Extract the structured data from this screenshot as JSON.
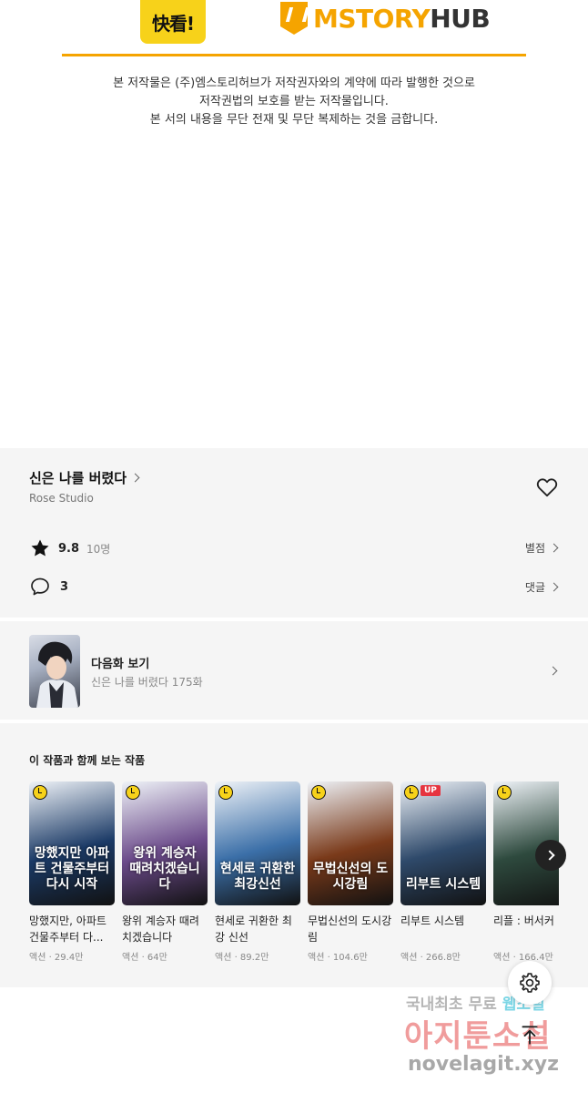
{
  "banner": {
    "logo_kuai_text": "快看!",
    "logo_mstory_part1": "MSTORY",
    "logo_mstory_part2": "HUB",
    "accent_color": "#f5a400"
  },
  "copyright": {
    "line1": "본 저작물은 (주)엠스토리허브가 저작권자와의 계약에 따라 발행한 것으로",
    "line2": "저작권법의 보호를 받는 저작물입니다.",
    "line3": "본 서의 내용을 무단 전재 및 무단 복제하는 것을 금합니다."
  },
  "work": {
    "title": "신은 나를 버렸다",
    "studio": "Rose Studio",
    "rating": "9.8",
    "raters": "10명",
    "rating_link": "별점",
    "comment_count": "3",
    "comment_link": "댓글"
  },
  "next_episode": {
    "label": "다음화 보기",
    "subtitle": "신은 나를 버렸다 175화"
  },
  "recommendations": {
    "heading": "이 작품과 함께 보는 작품",
    "items": [
      {
        "title": "망했지만, 아파트 건물주부터 다...",
        "meta": "액션 · 29.4만",
        "cover_text": "망했지만 아파트 건물주부터 다시 시작",
        "badge_up": false,
        "cover_color": "#1b3a66"
      },
      {
        "title": "왕위 계승자 때려치겠습니다",
        "meta": "액션 · 64만",
        "cover_text": "왕위 계승자 때려치겠습니다",
        "badge_up": false,
        "cover_color": "#6b4a8a"
      },
      {
        "title": "현세로 귀환한 최강 신선",
        "meta": "액션 · 89.2만",
        "cover_text": "현세로 귀환한 최강신선",
        "badge_up": false,
        "cover_color": "#3b6fa8"
      },
      {
        "title": "무법신선의 도시강림",
        "meta": "액션 · 104.6만",
        "cover_text": "무법신선의 도시강림",
        "badge_up": false,
        "cover_color": "#7a3a1a"
      },
      {
        "title": "리부트 시스템",
        "meta": "액션 · 266.8만",
        "cover_text": "리부트 시스템",
        "badge_up": true,
        "badge_text": "UP",
        "cover_color": "#2f4a6b"
      },
      {
        "title": "리플 : 버서커",
        "meta": "액션 · 166.4만",
        "cover_text": "",
        "badge_up": false,
        "cover_color": "#2e4a3e"
      }
    ]
  },
  "watermark": {
    "line1_a": "국내최초 무료 ",
    "line1_b": "웹소설",
    "line2": "아지툰소설",
    "line3": "novelagit.xyz"
  }
}
